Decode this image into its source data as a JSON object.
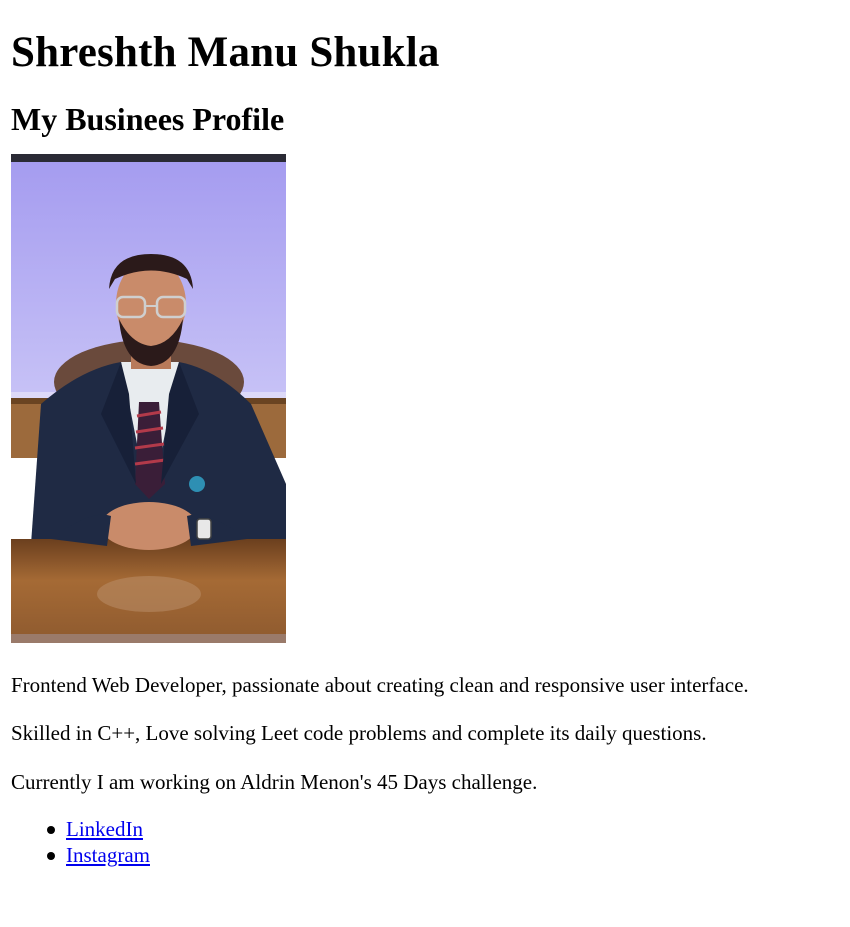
{
  "header": {
    "name": "Shreshth Manu Shukla",
    "subtitle": "My Businees Profile"
  },
  "profile_photo": {
    "colors": {
      "wall": "#aaa3f2",
      "wood": "#8a5a2c",
      "suit": "#1f2a44",
      "skin": "#c98b6a"
    }
  },
  "bio": {
    "line1": "Frontend Web Developer, passionate about creating clean and responsive user interface.",
    "line2": "Skilled in C++, Love solving Leet code problems and complete its daily questions.",
    "line3": "Currently I am working on Aldrin Menon's 45 Days challenge."
  },
  "links": [
    {
      "label": "LinkedIn"
    },
    {
      "label": "Instagram"
    }
  ]
}
